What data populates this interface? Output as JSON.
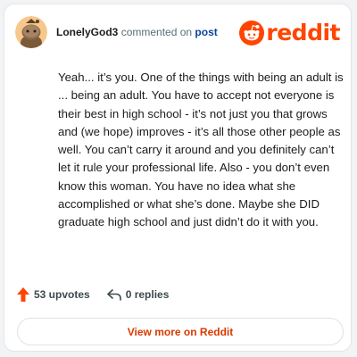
{
  "comment": {
    "username": "LonelyGod3",
    "action_text": "commented on",
    "post_link": "post",
    "body": "Yeah... it’s you. One of the things with being an adult is ... being an adult. You have to accept not everyone is their best in high school - it’s not just you that grows and (we hope) improves - it’s all those other people as well. You can’t carry it around and you definitely can’t let it rule your professional life. Also - you don’t even know this woman. You have no idea what she accomplished or what she’s done. Maybe she DID graduate high school and just didn’t do it with you."
  },
  "brand": {
    "wordmark": "reddit",
    "color": "#ff4500"
  },
  "actions": {
    "upvotes": "53 upvotes",
    "replies": "0 replies",
    "upvote_icon": "upvote-arrow-icon",
    "reply_icon": "reply-icon"
  },
  "footer": {
    "view_more_label": "View more on Reddit",
    "view_more_color": "#d93a00"
  },
  "colors": {
    "text": "#1c1c1c",
    "muted": "#576f76",
    "link": "#0a449b"
  }
}
